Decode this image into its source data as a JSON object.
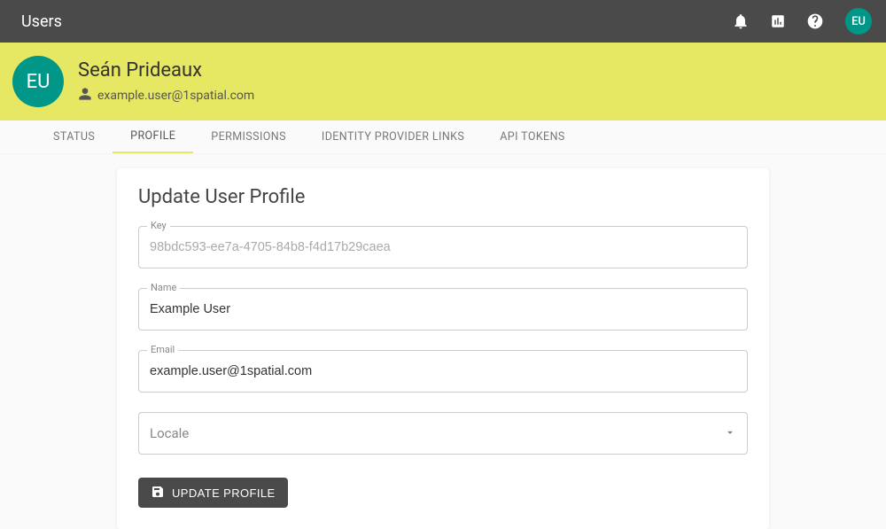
{
  "appbar": {
    "title": "Users",
    "avatar_initials": "EU"
  },
  "banner": {
    "avatar_initials": "EU",
    "name": "Seán Prideaux",
    "email": "example.user@1spatial.com"
  },
  "tabs": {
    "status": "STATUS",
    "profile": "PROFILE",
    "permissions": "PERMISSIONS",
    "identity_provider_links": "IDENTITY PROVIDER LINKS",
    "api_tokens": "API TOKENS"
  },
  "form": {
    "title": "Update User Profile",
    "key_label": "Key",
    "key_value": "98bdc593-ee7a-4705-84b8-f4d17b29caea",
    "name_label": "Name",
    "name_value": "Example User",
    "email_label": "Email",
    "email_value": "example.user@1spatial.com",
    "locale_placeholder": "Locale",
    "submit_label": "UPDATE PROFILE"
  }
}
